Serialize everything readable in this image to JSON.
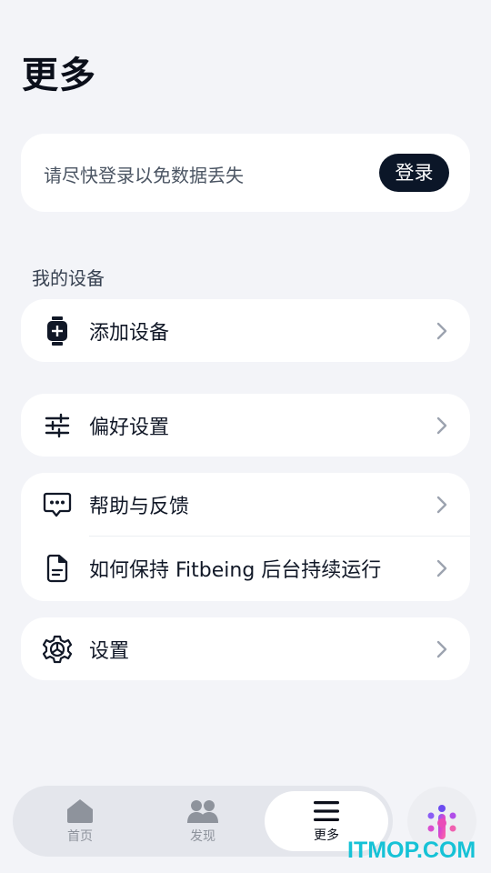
{
  "page": {
    "title": "更多"
  },
  "login_card": {
    "hint": "请尽快登录以免数据丢失",
    "button": "登录"
  },
  "devices": {
    "section_label": "我的设备",
    "add_device": {
      "label": "添加设备",
      "icon": "watch-add-icon"
    }
  },
  "preferences": {
    "label": "偏好设置",
    "icon": "sliders-icon"
  },
  "help_group": {
    "items": [
      {
        "label": "帮助与反馈",
        "icon": "chat-dots-icon"
      },
      {
        "label": "如何保持 Fitbeing 后台持续运行",
        "icon": "phone-doc-icon"
      }
    ]
  },
  "settings": {
    "label": "设置",
    "icon": "gear-icon"
  },
  "tabbar": {
    "tabs": [
      {
        "label": "首页",
        "icon": "home-icon",
        "active": false
      },
      {
        "label": "发现",
        "icon": "people-icon",
        "active": false
      },
      {
        "label": "更多",
        "icon": "menu-icon",
        "active": true
      }
    ]
  },
  "watermark": "ITMOP.COM",
  "colors": {
    "accent_dark": "#0b1628",
    "background": "#f3f4f8",
    "watermark": "#16c2d6"
  }
}
